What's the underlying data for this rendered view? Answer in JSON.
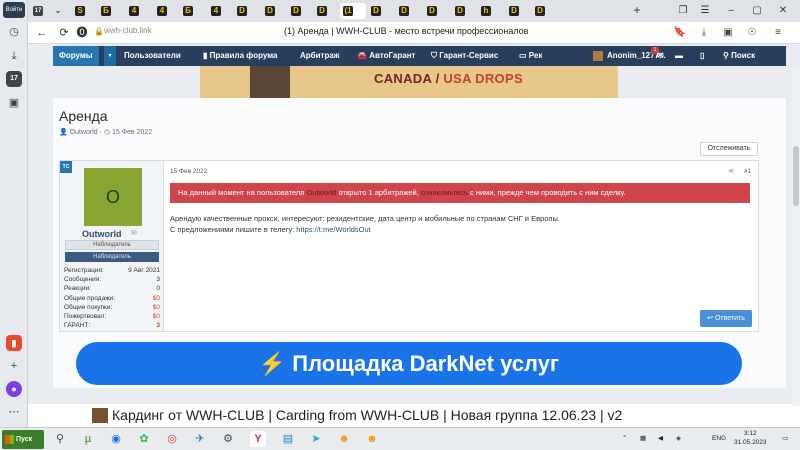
{
  "sidebar": {
    "profile_label": "Войти",
    "items": [
      "history",
      "downloads",
      "calendar",
      "screens",
      "add",
      "alice",
      "more"
    ]
  },
  "tabs": [
    {
      "label": "S"
    },
    {
      "label": "Б"
    },
    {
      "label": "4"
    },
    {
      "label": "4"
    },
    {
      "label": "Б"
    },
    {
      "label": "4"
    },
    {
      "label": "D"
    },
    {
      "label": "D"
    },
    {
      "label": "D"
    },
    {
      "label": "D"
    },
    {
      "label": "(1"
    },
    {
      "label": "D"
    },
    {
      "label": "D"
    },
    {
      "label": "D"
    },
    {
      "label": "D"
    },
    {
      "label": "h"
    },
    {
      "label": "D"
    },
    {
      "label": "D"
    }
  ],
  "address_bar": {
    "url": "wwh-club.link",
    "page_title": "(1) Аренда | WWH-CLUB - место встречи профессионалов"
  },
  "forum_nav": {
    "items": [
      "Форумы",
      "Пользователи",
      "Правила форума",
      "Арбитраж",
      "АвтоГарант",
      "Гарант-Сервис",
      "Рек",
      "Anonim_1277...",
      "Поиск"
    ],
    "badge_count": "1"
  },
  "banner": {
    "text_a": "CANADA",
    "text_sep": " / ",
    "text_b": "USA DROPS"
  },
  "thread": {
    "title": "Аренда",
    "author": "Outworld",
    "date": "15 Фев 2022",
    "follow_label": "Отслеживать"
  },
  "post": {
    "tc_label": "ТС",
    "date": "15 Фев 2022",
    "number": "#1",
    "warning_pre": "На данный момент на пользователя ",
    "warning_user": "Outworld",
    "warning_mid": " открыто 1 арбитражей, ",
    "warning_link": "ознакомьтесь",
    "warning_post": " с ними, прежде чем проводить с ним сделку.",
    "text_line1": "Арендую качественные прокси, интересуют: резидентские, дата центр и мобильные по странам СНГ и Европы.",
    "text_line2_pre": "С предложениями пишите в телегу: ",
    "text_link": "https://t.me/WorldsOut",
    "reply_label": "Ответить"
  },
  "user": {
    "avatar_letter": "O",
    "name": "Outworld",
    "role1": "Наблюдатель",
    "role2": "Наблюдатель",
    "stats": [
      {
        "k": "Регистрация:",
        "v": "9 Авг 2021"
      },
      {
        "k": "Сообщения:",
        "v": "3"
      },
      {
        "k": "Реакции:",
        "v": "0"
      },
      {
        "k": "Общие продажи:",
        "v": "$0"
      },
      {
        "k": "Общие покупки:",
        "v": "$0"
      },
      {
        "k": "Пожертвовал:",
        "v": "$0"
      },
      {
        "k": "ГАРАНТ:",
        "v": "3"
      }
    ]
  },
  "ad_darknet": {
    "label": "Площадка DarkNet услуг"
  },
  "bottom_banner": {
    "label": "Кардинг от WWH-CLUB | Carding from WWH-CLUB | Новая группа 12.06.23 | v2"
  },
  "taskbar": {
    "start_label": "Пуск",
    "lang": "ENG",
    "time": "3:12",
    "date": "31.05.2023"
  }
}
